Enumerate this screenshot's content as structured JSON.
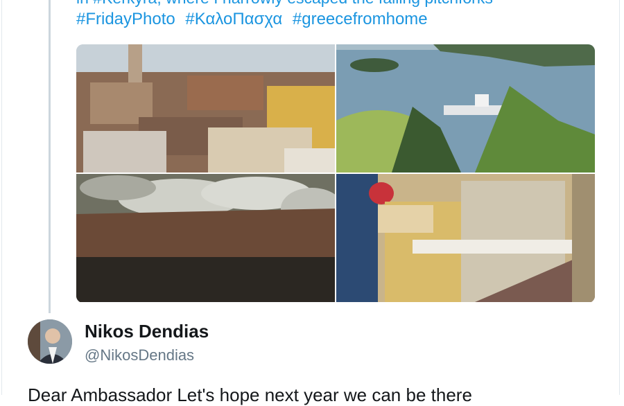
{
  "quoted_tweet": {
    "text_partial": "in #Kerkyra, where I narrowly escaped the falling pitchforks",
    "hashtags": [
      "#FridayPhoto",
      "#ΚαλοΠασχα",
      "#greecefromhome"
    ],
    "photos": [
      {
        "id": "town-rooftops",
        "desc": "Corfu town rooftops"
      },
      {
        "id": "harbor-island",
        "desc": "harbor and islet"
      },
      {
        "id": "fire-smoke",
        "desc": "smoke over rooftop"
      },
      {
        "id": "street-crowd",
        "desc": "crowded street with pots"
      }
    ]
  },
  "tweet": {
    "author_name": "Nikos Dendias",
    "author_handle": "@NikosDendias",
    "text_partial": "Dear Ambassador Let's hope next year we can be there"
  },
  "colors": {
    "link": "#1b95e0",
    "name": "#14171a",
    "handle": "#657786",
    "quote_bar": "#ccd6dd"
  }
}
